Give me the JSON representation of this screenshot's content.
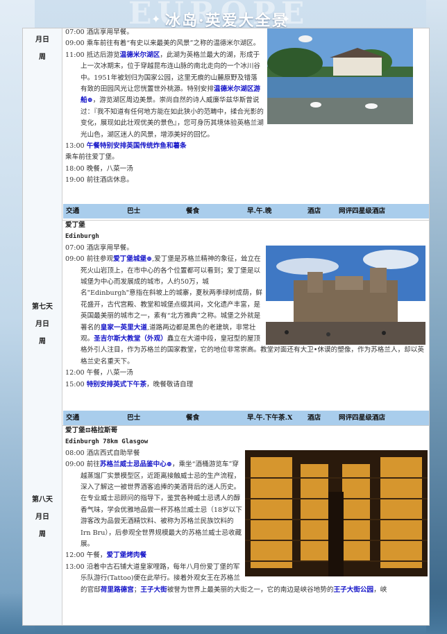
{
  "header": {
    "title": "冰岛·英爱大全景",
    "watermark": "EUROPE"
  },
  "day6": {
    "day_label": [
      "月日",
      "周"
    ],
    "lines": [
      {
        "time": "07:00",
        "parts": [
          {
            "t": "酒店享用早餐。"
          }
        ]
      },
      {
        "time": "09:00",
        "parts": [
          {
            "t": "乘车前往有着“有史以来最美的风景”之称的温德米尔湖区。"
          }
        ]
      },
      {
        "time": "11:00",
        "parts": [
          {
            "t": "抵达后游览"
          },
          {
            "t": "温德米尔湖区",
            "hl": true
          },
          {
            "t": "，此湖为英格兰最大的湖，形成于上一次冰期末，位于穿越昆布连山脉的南北走向的一个冰川谷中。1951年被划归为国家公园，这里无痕的山麓原野及错落有致的田园风光让您恍置世外桃源。特别安排"
          },
          {
            "t": "温德米尔湖区游船⊕",
            "hl": true
          },
          {
            "t": "，游览湖区周边美景。崇尚自然的诗人威廉华兹华斯曾说过：『我不知道有任何地方能在如此狭小的范畴中，揉合光影的变化，展现如此壮观优美的景色』，您可身历其境体验英格兰湖光山色，湖区迷人的风景，增添美好的回忆。"
          }
        ]
      },
      {
        "time": "13:00",
        "parts": [
          {
            "t": "午餐特别安排英国传统炸鱼和薯条",
            "hl": true
          }
        ]
      },
      {
        "time": "",
        "parts": [
          {
            "t": "乘车前往爱丁堡。"
          }
        ]
      },
      {
        "time": "18:00",
        "parts": [
          {
            "t": "晚餐，八菜一汤"
          }
        ]
      },
      {
        "time": "19:00",
        "parts": [
          {
            "t": "前往酒店休息。"
          }
        ]
      }
    ],
    "strip": [
      "交通",
      "巴士",
      "餐食",
      "早.午.晚",
      "酒店",
      "网评四星级酒店"
    ]
  },
  "day7": {
    "day_label": [
      "第七天",
      "月日",
      "周"
    ],
    "route": "爱丁堡",
    "route_en": "Edinburgh",
    "lines": [
      {
        "time": "07:00",
        "parts": [
          {
            "t": "酒店享用早餐。"
          }
        ]
      },
      {
        "time": "09:00",
        "parts": [
          {
            "t": "前往参观"
          },
          {
            "t": "爱丁堡城堡⊕",
            "hl": true
          },
          {
            "t": ",爱丁堡是苏格兰精神的象征，耸立在死火山岩顶上，在市中心的各个位置都可以看到；爱丁堡是以城堡为中心而发展成的城市，人约50万，城名\"Edinburgh\"意指在斜坡上的城寨，夏秋两季绿树成荫，鲜花盛开，古代宫殿、教堂和城堡点缀其间，文化遗产丰富，是英国最美丽的城市之一，素有“北方雅典”之称。城堡之外就是著名的"
          },
          {
            "t": "皇家一英里大道",
            "hl": true
          },
          {
            "t": ",道路两边都是黑色的老建筑，非常壮观。"
          },
          {
            "t": "圣吉尔斯大教堂（外观）",
            "hl": true
          },
          {
            "t": "矗立在大道中段，皇冠型的屋顶格外引人注目，作为苏格兰的国家教堂，它的地位非常崇高。教堂对面还有大卫•休谟的塑像，作为苏格兰人，却以英格兰史名重天下。"
          }
        ]
      },
      {
        "time": "12:00",
        "parts": [
          {
            "t": "午餐，八菜一汤"
          }
        ]
      },
      {
        "time": "15:00",
        "parts": [
          {
            "t": "特别安排英式下午茶",
            "hl": true
          },
          {
            "t": "，晚餐敬请自理"
          }
        ]
      }
    ],
    "strip": [
      "交通",
      "巴士",
      "餐食",
      "早.午.下午茶.X",
      "酒店",
      "网评四星级酒店"
    ]
  },
  "day8": {
    "day_label": [
      "第八天",
      "月日",
      "周"
    ],
    "route": "爱丁堡⊡格拉斯哥",
    "route_en": "Edinburgh 78km Glasgow",
    "lines": [
      {
        "time": "08:00",
        "parts": [
          {
            "t": "酒店西式自助早餐"
          }
        ]
      },
      {
        "time": "09:00",
        "parts": [
          {
            "t": "前往"
          },
          {
            "t": "苏格兰威士忌品鉴中心⊕",
            "hl": true
          },
          {
            "t": "，乘坐“酒桶游览车”穿越蒸馏厂实景模型区，近距离接触威士忌的生产流程，深入了解这一被世界酒客追捧的美酒背后的迷人历史。在专业威士忌顾问的指导下，鉴赏各种威士忌诱人的醇香气味，学会优雅地品尝一杯苏格兰威士忌（18岁以下游客改为品尝无酒精饮料、被称为苏格兰民族饮料的Irn Bru），后参观全世界规模最大的苏格兰威士忌收藏展。"
          }
        ]
      },
      {
        "time": "12:00",
        "parts": [
          {
            "t": "午餐，"
          },
          {
            "t": "爱丁堡烤肉餐",
            "hl": true
          }
        ]
      },
      {
        "time": "13:00",
        "parts": [
          {
            "t": "沿着中古石铺大道皇家哩路，每年八月份爱丁堡的军乐队游行(Tattoo)便在此举行。接着外观女王在苏格兰的官邸"
          },
          {
            "t": "荷里路德宫",
            "hl": true
          },
          {
            "t": "；"
          },
          {
            "t": "王子大街",
            "hl": true
          },
          {
            "t": "被誉为世界上最美丽的大街之一，它的南边是峡谷地势的"
          },
          {
            "t": "王子大街公园",
            "hl": true
          },
          {
            "t": "，峡"
          }
        ]
      }
    ]
  }
}
